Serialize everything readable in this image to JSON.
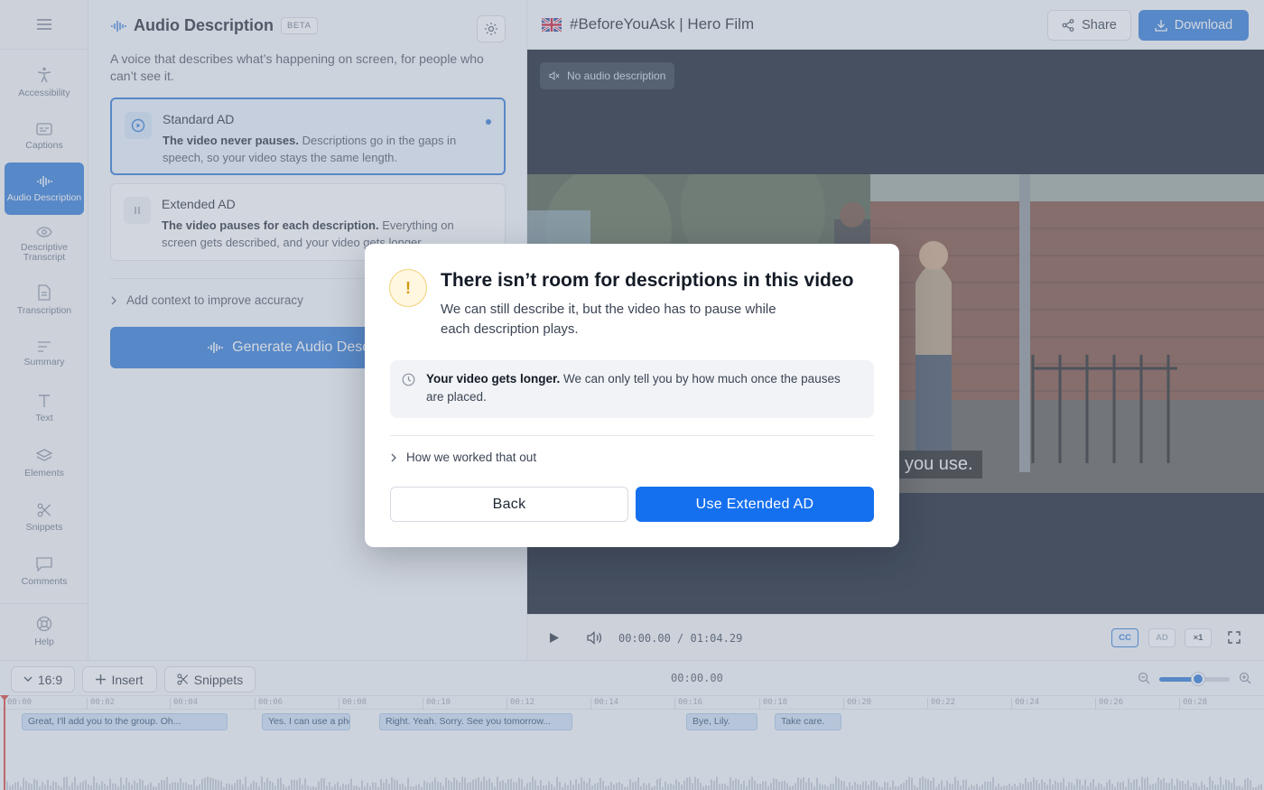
{
  "rail": {
    "items": [
      {
        "label": "Accessibility",
        "icon": "accessibility-icon"
      },
      {
        "label": "Captions",
        "icon": "captions-icon"
      },
      {
        "label": "Audio Description",
        "icon": "audio-wave-icon",
        "active": true
      },
      {
        "label": "Descriptive Transcript",
        "icon": "eye-icon"
      },
      {
        "label": "Transcription",
        "icon": "document-icon"
      },
      {
        "label": "Summary",
        "icon": "summary-icon"
      },
      {
        "label": "Text",
        "icon": "text-icon"
      },
      {
        "label": "Elements",
        "icon": "layers-icon"
      },
      {
        "label": "Snippets",
        "icon": "scissors-icon"
      },
      {
        "label": "Comments",
        "icon": "comment-icon"
      },
      {
        "label": "Help",
        "icon": "lifebuoy-icon"
      }
    ]
  },
  "panel": {
    "title": "Audio Description",
    "badge": "BETA",
    "description": "A voice that describes what’s happening on screen, for people who can’t see it.",
    "options": [
      {
        "title": "Standard AD",
        "bold": "The video never pauses.",
        "text": " Descriptions go in the gaps in speech, so your video stays the same length."
      },
      {
        "title": "Extended AD",
        "bold": "The video pauses for each description.",
        "text": " Everything on screen gets described, and your video gets longer."
      }
    ],
    "context_label": "Add context to improve accuracy",
    "generate_label": "Generate Audio Description"
  },
  "topbar": {
    "project_title": "#BeforeYouAsk | Hero Film",
    "share_label": "Share",
    "download_label": "Download"
  },
  "video": {
    "no_ad_label": "No audio description",
    "caption": "you use."
  },
  "player": {
    "current_time": "00:00.00",
    "separator": "/",
    "duration": "01:04.29",
    "cc_label": "CC",
    "ad_label": "AD",
    "speed_label": "×1"
  },
  "timeline": {
    "aspect_label": "16:9",
    "insert_label": "Insert",
    "snippets_label": "Snippets",
    "time": "00:00.00",
    "zoom_level": 0.55,
    "ticks": [
      "00:00",
      "00:02",
      "00:04",
      "00:06",
      "00:08",
      "00:10",
      "00:12",
      "00:14",
      "00:16",
      "00:18",
      "00:20",
      "00:22",
      "00:24",
      "00:26",
      "00:28"
    ],
    "segments": [
      {
        "text": "Great, I'll add you to the group. Oh..."
      },
      {
        "text": "Yes. I can use a phone."
      },
      {
        "text": "Right. Yeah. Sorry. See you tomorrow..."
      },
      {
        "text": "Bye, Lily."
      },
      {
        "text": "Take care."
      }
    ]
  },
  "modal": {
    "warning_glyph": "!",
    "title": "There isn’t room for descriptions in this video",
    "subtitle": "We can still describe it, but the video has to pause while each description plays.",
    "info_bold": "Your video gets longer.",
    "info_text": " We can only tell you by how much once the pauses are placed.",
    "how_label": "How we worked that out",
    "back_label": "Back",
    "confirm_label": "Use Extended AD"
  },
  "colors": {
    "accent": "#2b77d6",
    "primary_button": "#1570ef",
    "warning": "#d59a10",
    "playhead": "#d9403a"
  }
}
